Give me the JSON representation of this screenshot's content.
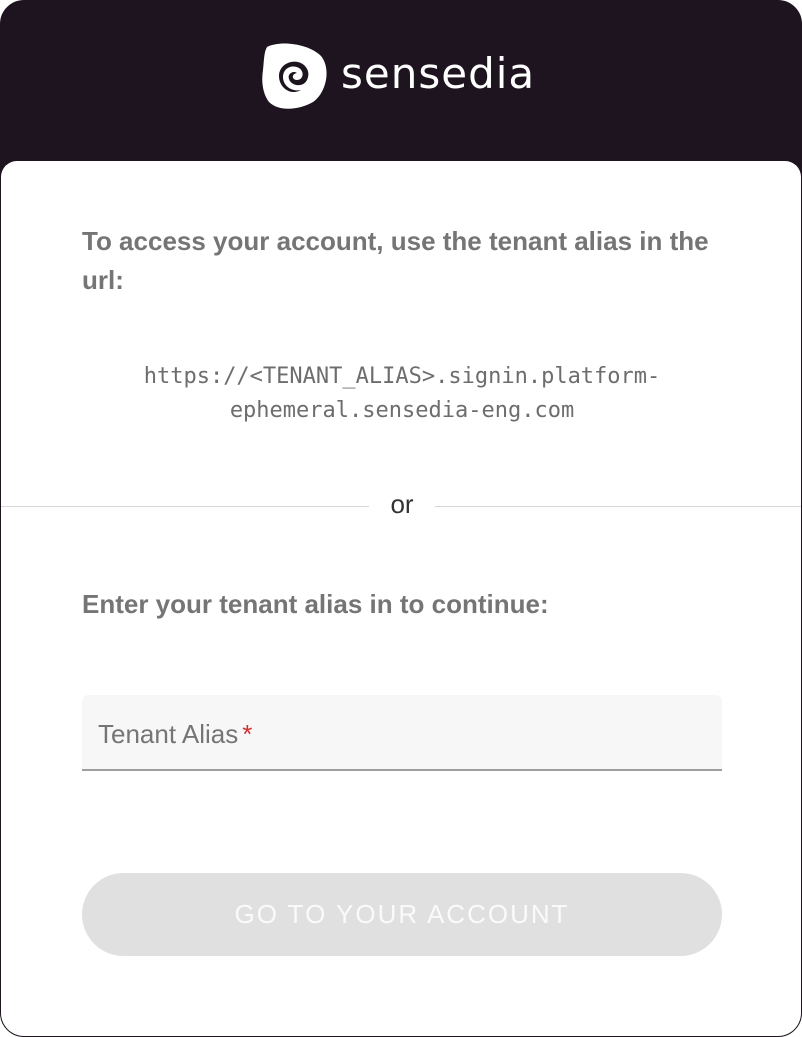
{
  "brand": {
    "name": "sensedia",
    "logo_icon": "sensedia-logo-icon"
  },
  "colors": {
    "header_bg": "#1e1420",
    "text_muted": "#757575",
    "required": "#d32f2f",
    "button_disabled_bg": "#e0e0e0"
  },
  "instructions": {
    "text": "To access your account, use the tenant alias in the url:",
    "url_line1": "https://<TENANT_ALIAS>.signin.platform-",
    "url_line2": "ephemeral.sensedia-eng.com"
  },
  "divider": {
    "label": "or"
  },
  "form": {
    "prompt": "Enter your tenant alias in to continue:",
    "tenant_field": {
      "label": "Tenant Alias",
      "required_mark": "*",
      "value": ""
    },
    "submit_label": "GO TO YOUR ACCOUNT",
    "submit_disabled": true
  }
}
